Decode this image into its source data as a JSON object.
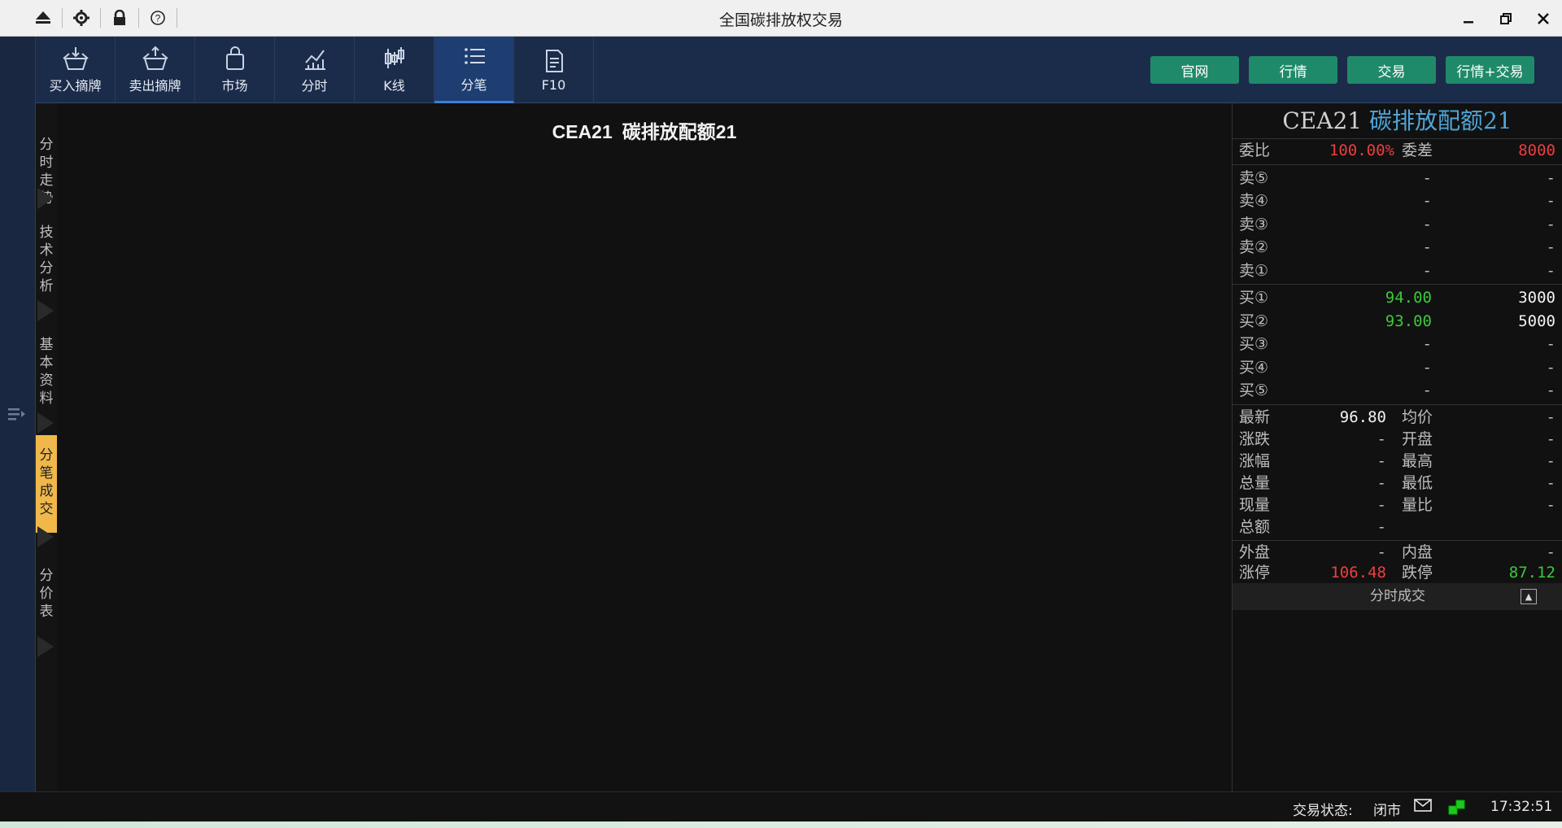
{
  "window": {
    "title": "全国碳排放权交易"
  },
  "toolbar": {
    "tools": [
      {
        "label": "买入摘牌",
        "icon": "basket-down-icon"
      },
      {
        "label": "卖出摘牌",
        "icon": "basket-up-icon"
      },
      {
        "label": "市场",
        "icon": "bag-icon"
      },
      {
        "label": "分时",
        "icon": "line-chart-icon"
      },
      {
        "label": "K线",
        "icon": "candlestick-icon"
      },
      {
        "label": "分笔",
        "icon": "list-icon",
        "active": true
      },
      {
        "label": "F10",
        "icon": "document-icon"
      }
    ],
    "links": [
      "官网",
      "行情",
      "交易",
      "行情+交易"
    ]
  },
  "vtabs": [
    "分时走势",
    "技术分析",
    "基本资料",
    "分笔成交",
    "分价表"
  ],
  "main": {
    "code": "CEA21",
    "name": "碳排放配额21"
  },
  "quote": {
    "code": "CEA21",
    "name": "碳排放配额21",
    "ratio_label": "委比",
    "ratio_value": "100.00%",
    "diff_label": "委差",
    "diff_value": "8000",
    "asks": [
      {
        "label": "卖⑤",
        "price": "-",
        "qty": "-"
      },
      {
        "label": "卖④",
        "price": "-",
        "qty": "-"
      },
      {
        "label": "卖③",
        "price": "-",
        "qty": "-"
      },
      {
        "label": "卖②",
        "price": "-",
        "qty": "-"
      },
      {
        "label": "卖①",
        "price": "-",
        "qty": "-"
      }
    ],
    "bids": [
      {
        "label": "买①",
        "price": "94.00",
        "qty": "3000"
      },
      {
        "label": "买②",
        "price": "93.00",
        "qty": "5000"
      },
      {
        "label": "买③",
        "price": "-",
        "qty": "-"
      },
      {
        "label": "买④",
        "price": "-",
        "qty": "-"
      },
      {
        "label": "买⑤",
        "price": "-",
        "qty": "-"
      }
    ],
    "stats": [
      {
        "l1": "最新",
        "v1": "96.80",
        "l2": "均价",
        "v2": "-"
      },
      {
        "l1": "涨跌",
        "v1": "-",
        "l2": "开盘",
        "v2": "-"
      },
      {
        "l1": "涨幅",
        "v1": "-",
        "l2": "最高",
        "v2": "-"
      },
      {
        "l1": "总量",
        "v1": "-",
        "l2": "最低",
        "v2": "-"
      },
      {
        "l1": "现量",
        "v1": "-",
        "l2": "量比",
        "v2": "-"
      },
      {
        "l1": "总额",
        "v1": "-",
        "l2": "",
        "v2": ""
      }
    ],
    "outer_label": "外盘",
    "outer_value": "-",
    "inner_label": "内盘",
    "inner_value": "-",
    "limit_up_label": "涨停",
    "limit_up_value": "106.48",
    "limit_down_label": "跌停",
    "limit_down_value": "87.12",
    "footer_label": "分时成交"
  },
  "status": {
    "label": "交易状态:",
    "value": "闭市",
    "time": "17:32:51"
  },
  "colors": {
    "up": "#ef3d3d",
    "down": "#3cc83c",
    "accent_tab": "#f0b84a",
    "link_btn": "#1f8a6a"
  }
}
